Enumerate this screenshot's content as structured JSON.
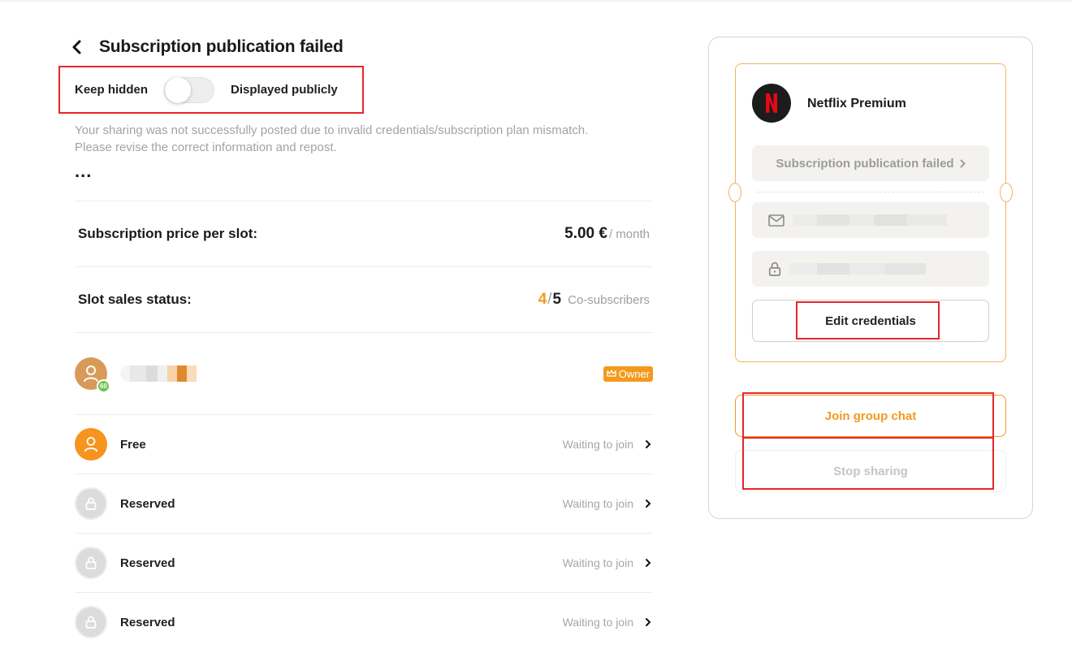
{
  "header": {
    "title": "Subscription publication failed"
  },
  "visibility": {
    "left_label": "Keep hidden",
    "right_label": "Displayed publicly",
    "is_public": false
  },
  "message": {
    "line1": "Your sharing was not successfully posted due to invalid credentials/subscription plan mismatch.",
    "line2": "Please revise the correct information and repost.",
    "more": "..."
  },
  "price": {
    "label": "Subscription price per slot:",
    "amount": "5.00 €",
    "unit": "/ month"
  },
  "slots": {
    "label": "Slot sales status:",
    "sold": "4",
    "separator": "/",
    "total": "5",
    "unit": "Co-subscribers"
  },
  "members": [
    {
      "role": "owner",
      "badge": "Owner",
      "level": "60",
      "name_hidden": true
    },
    {
      "role": "free",
      "name": "Free",
      "status": "Waiting to join"
    },
    {
      "role": "reserved",
      "name": "Reserved",
      "status": "Waiting to join"
    },
    {
      "role": "reserved",
      "name": "Reserved",
      "status": "Waiting to join"
    },
    {
      "role": "reserved",
      "name": "Reserved",
      "status": "Waiting to join"
    }
  ],
  "panel": {
    "service_name": "Netflix Premium",
    "status_chip": "Subscription publication failed",
    "edit_credentials": "Edit credentials",
    "join_group_chat": "Join group chat",
    "stop_sharing": "Stop sharing"
  },
  "colors": {
    "accent": "#f39a1e",
    "highlight_box": "#e6262a",
    "netflix_red": "#e50914"
  }
}
